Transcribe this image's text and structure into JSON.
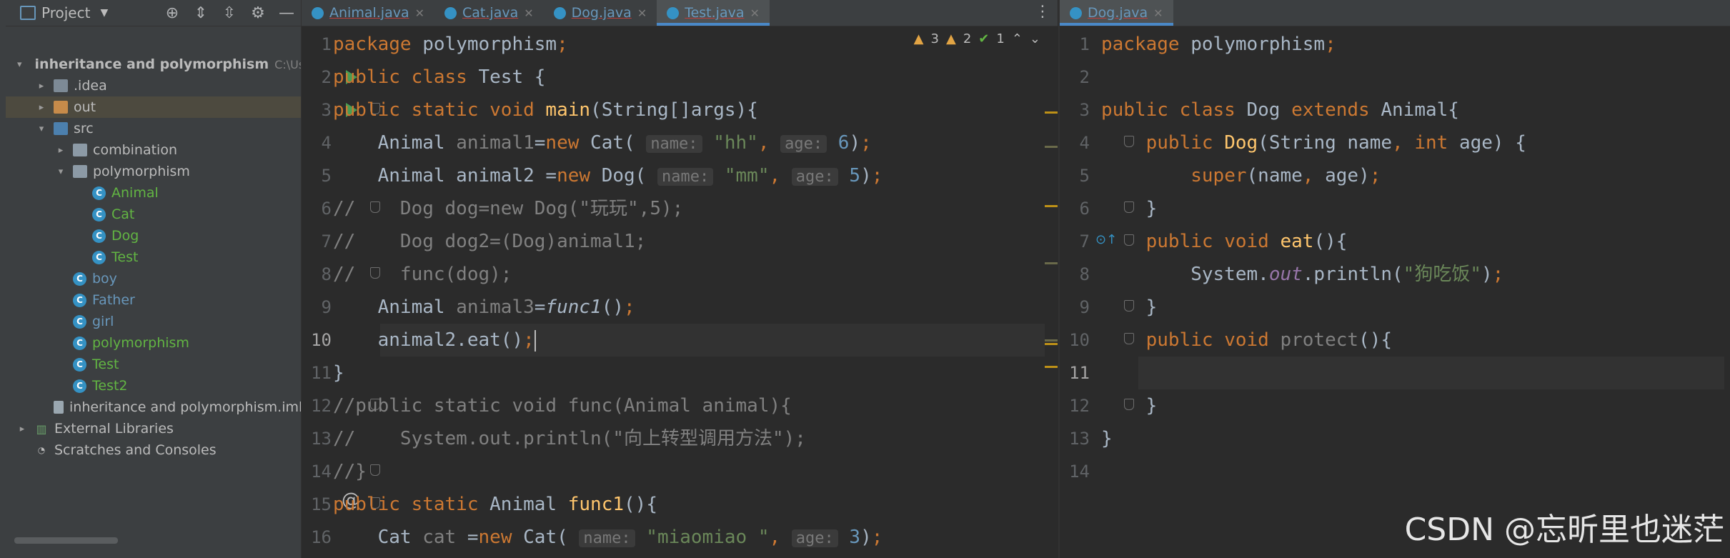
{
  "project": {
    "title": "Project",
    "tree": [
      {
        "label": "inheritance and polymorphism",
        "extra": "C:\\User",
        "depth": 0,
        "arrow": "▾",
        "icon": "module",
        "bold": true
      },
      {
        "label": ".idea",
        "depth": 1,
        "arrow": "▸",
        "icon": "folder"
      },
      {
        "label": "out",
        "depth": 1,
        "arrow": "▸",
        "icon": "folder-out",
        "selected": true
      },
      {
        "label": "src",
        "depth": 1,
        "arrow": "▾",
        "icon": "folder-src"
      },
      {
        "label": "combination",
        "depth": 2,
        "arrow": "▸",
        "icon": "package"
      },
      {
        "label": "polymorphism",
        "depth": 2,
        "arrow": "▾",
        "icon": "package"
      },
      {
        "label": "Animal",
        "depth": 3,
        "icon": "class",
        "color": "green"
      },
      {
        "label": "Cat",
        "depth": 3,
        "icon": "class",
        "color": "green"
      },
      {
        "label": "Dog",
        "depth": 3,
        "icon": "class",
        "color": "green"
      },
      {
        "label": "Test",
        "depth": 3,
        "icon": "class",
        "color": "green"
      },
      {
        "label": "boy",
        "depth": 2,
        "icon": "class",
        "color": "blue"
      },
      {
        "label": "Father",
        "depth": 2,
        "icon": "class",
        "color": "blue"
      },
      {
        "label": "girl",
        "depth": 2,
        "icon": "class",
        "color": "blue"
      },
      {
        "label": "polymorphism",
        "depth": 2,
        "icon": "class",
        "color": "green"
      },
      {
        "label": "Test",
        "depth": 2,
        "icon": "class",
        "color": "green"
      },
      {
        "label": "Test2",
        "depth": 2,
        "icon": "class",
        "color": "green"
      },
      {
        "label": "inheritance and polymorphism.iml",
        "depth": 1,
        "icon": "iml"
      },
      {
        "label": "External Libraries",
        "depth": 0,
        "arrow": "▸",
        "icon": "lib"
      },
      {
        "label": "Scratches and Consoles",
        "depth": 0,
        "icon": "scratch"
      }
    ]
  },
  "editor_left": {
    "tabs": [
      {
        "label": "Animal.java",
        "active": false
      },
      {
        "label": "Cat.java",
        "active": false
      },
      {
        "label": "Dog.java",
        "active": false
      },
      {
        "label": "Test.java",
        "active": true
      }
    ],
    "inspections": {
      "warnings": "3",
      "weak": "2",
      "ok": "1"
    },
    "line_numbers": [
      "1",
      "2",
      "3",
      "4",
      "5",
      "6",
      "7",
      "8",
      "9",
      "10",
      "11",
      "12",
      "13",
      "14",
      "15",
      "16"
    ],
    "current_line": 10
  },
  "editor_right": {
    "tabs": [
      {
        "label": "Dog.java",
        "active": true
      }
    ],
    "line_numbers": [
      "1",
      "2",
      "3",
      "4",
      "5",
      "6",
      "7",
      "8",
      "9",
      "10",
      "11",
      "12",
      "13",
      "14"
    ],
    "current_line": 11
  },
  "watermark": "CSDN @忘昕里也迷茫"
}
